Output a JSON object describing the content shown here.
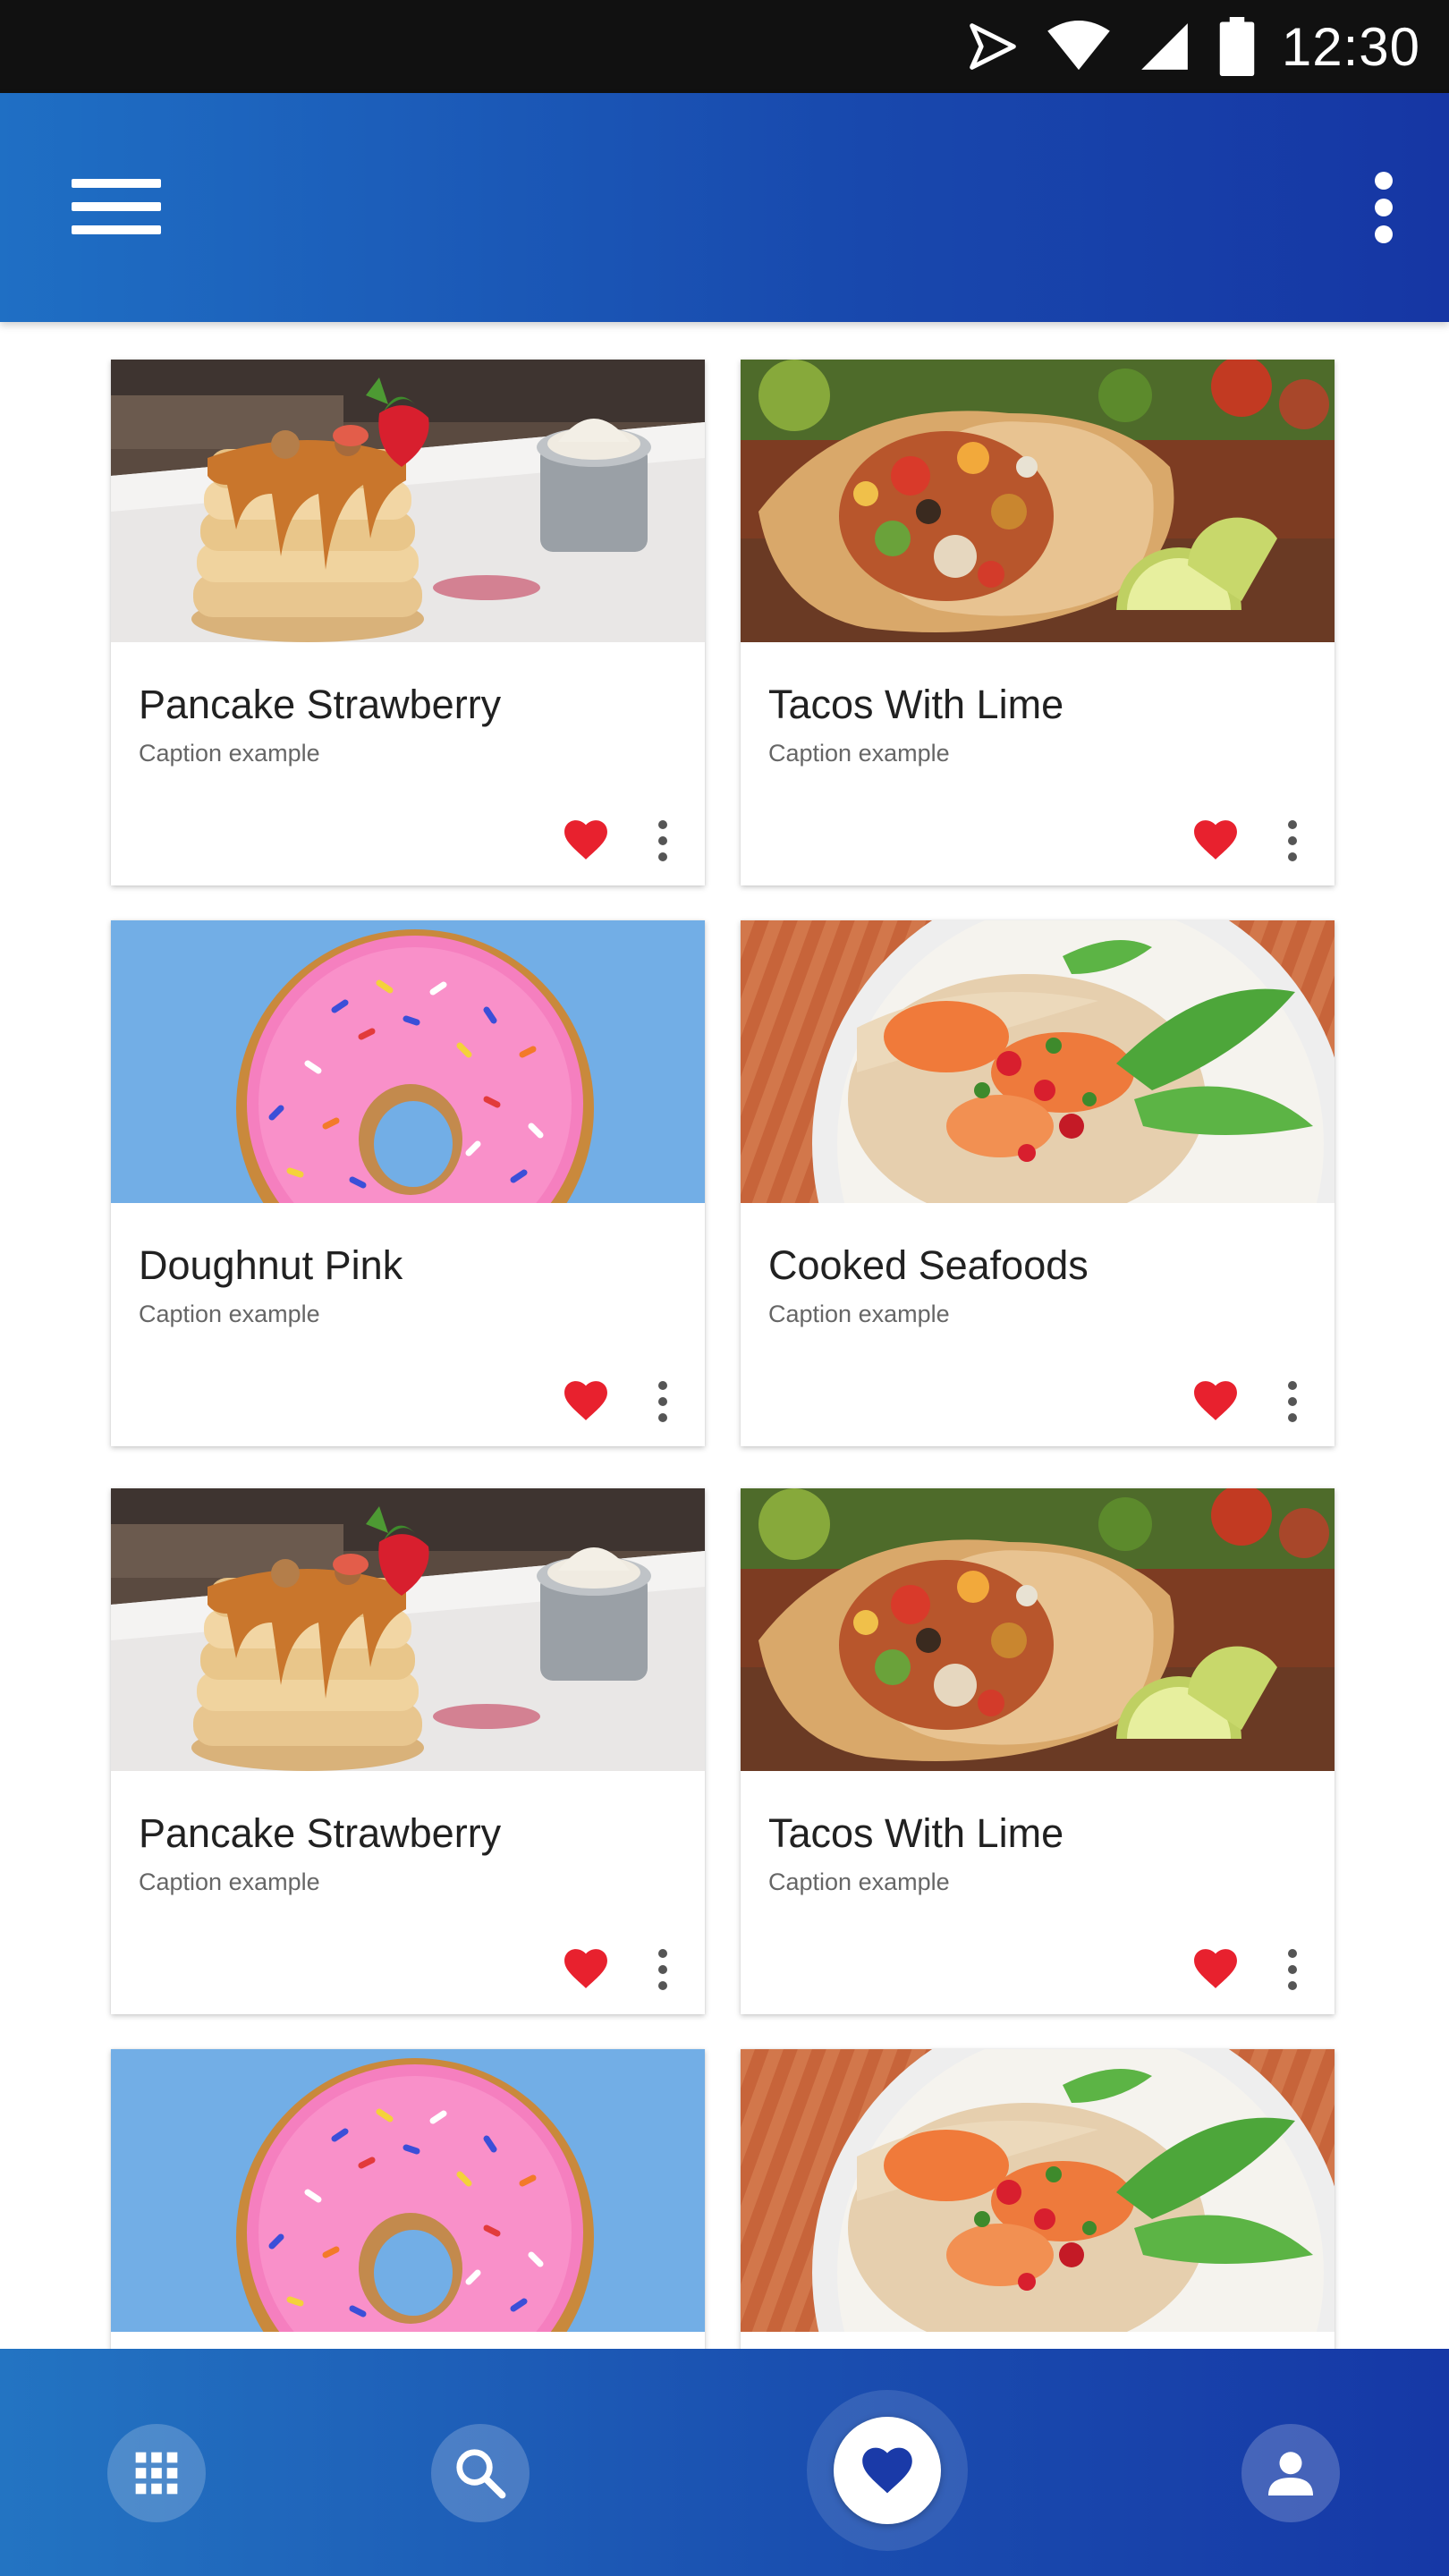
{
  "status_bar": {
    "time": "12:30",
    "icons": [
      "send-icon",
      "wifi-icon",
      "signal-icon",
      "battery-icon"
    ]
  },
  "app_bar": {
    "menu_icon": "hamburger-menu-icon",
    "more_icon": "more-vertical-icon",
    "gradient": [
      "#1f6fc4",
      "#1636a4"
    ]
  },
  "cards": [
    {
      "title": "Pancake Strawberry",
      "caption": "Caption example",
      "image": "pancake-stack-photo",
      "favorite": true
    },
    {
      "title": "Tacos With Lime",
      "caption": "Caption example",
      "image": "burrito-with-lime-photo",
      "favorite": true
    },
    {
      "title": "Doughnut Pink",
      "caption": "Caption example",
      "image": "pink-doughnut-photo",
      "favorite": true
    },
    {
      "title": "Cooked Seafoods",
      "caption": "Caption example",
      "image": "seafood-noodle-bowl-photo",
      "favorite": true
    },
    {
      "title": "Pancake Strawberry",
      "caption": "Caption example",
      "image": "pancake-stack-photo",
      "favorite": true
    },
    {
      "title": "Tacos With Lime",
      "caption": "Caption example",
      "image": "burrito-with-lime-photo",
      "favorite": true
    },
    {
      "title": "",
      "caption": "",
      "image": "pink-doughnut-photo",
      "favorite": true
    },
    {
      "title": "",
      "caption": "",
      "image": "seafood-noodle-bowl-photo",
      "favorite": true
    }
  ],
  "bottom_nav": {
    "items": [
      {
        "icon": "apps-grid-icon",
        "active": false
      },
      {
        "icon": "search-icon",
        "active": false
      },
      {
        "icon": "heart-icon",
        "active": true
      },
      {
        "icon": "person-icon",
        "active": false
      }
    ],
    "gradient": [
      "#2374c2",
      "#1638a6"
    ]
  },
  "colors": {
    "heart": "#e8212e",
    "active_heart": "#1a3aa8",
    "title_text": "#212121",
    "caption_text": "#666666"
  }
}
